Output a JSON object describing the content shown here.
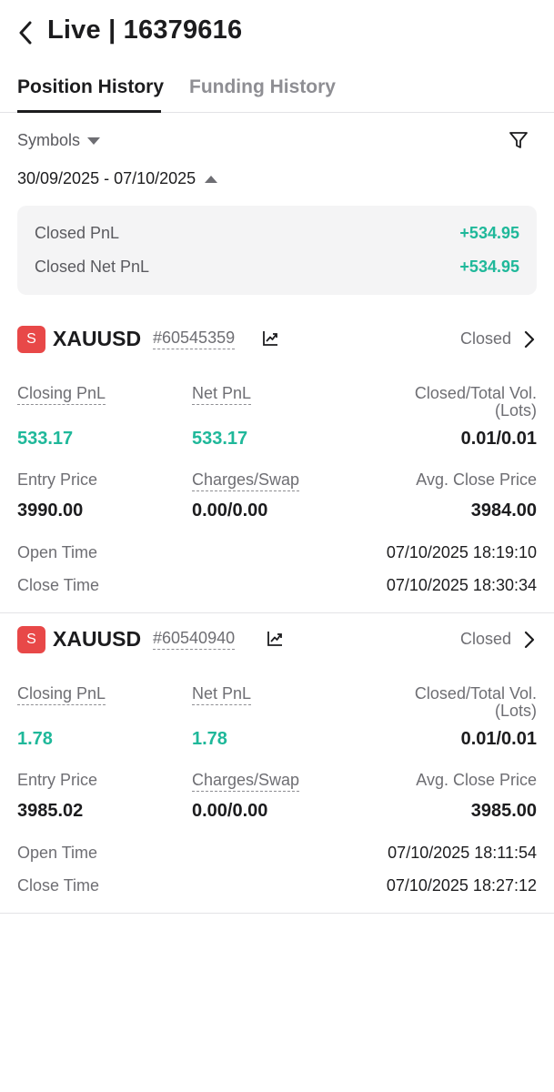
{
  "header": {
    "title": "Live | 16379616"
  },
  "tabs": [
    {
      "label": "Position History"
    },
    {
      "label": "Funding History"
    }
  ],
  "filters": {
    "symbols_label": "Symbols",
    "date_range": "30/09/2025 - 07/10/2025"
  },
  "summary": {
    "closed_pnl_label": "Closed PnL",
    "closed_pnl_value": "+534.95",
    "closed_net_pnl_label": "Closed Net PnL",
    "closed_net_pnl_value": "+534.95"
  },
  "labels": {
    "closing_pnl": "Closing PnL",
    "net_pnl": "Net PnL",
    "closed_total_vol": "Closed/Total Vol.",
    "lots": "(Lots)",
    "entry_price": "Entry Price",
    "charges_swap": "Charges/Swap",
    "avg_close_price": "Avg. Close Price",
    "open_time": "Open Time",
    "close_time": "Close Time"
  },
  "positions": [
    {
      "badge": "S",
      "symbol": "XAUUSD",
      "order_id": "#60545359",
      "status": "Closed",
      "closing_pnl": "533.17",
      "net_pnl": "533.17",
      "volume": "0.01/0.01",
      "entry_price": "3990.00",
      "charges_swap": "0.00/0.00",
      "avg_close_price": "3984.00",
      "open_time": "07/10/2025 18:19:10",
      "close_time": "07/10/2025 18:30:34"
    },
    {
      "badge": "S",
      "symbol": "XAUUSD",
      "order_id": "#60540940",
      "status": "Closed",
      "closing_pnl": "1.78",
      "net_pnl": "1.78",
      "volume": "0.01/0.01",
      "entry_price": "3985.02",
      "charges_swap": "0.00/0.00",
      "avg_close_price": "3985.00",
      "open_time": "07/10/2025 18:11:54",
      "close_time": "07/10/2025 18:27:12"
    }
  ],
  "colors": {
    "positive": "#1fb89a",
    "sell_badge": "#e84848",
    "text_primary": "#1c1c1e",
    "text_secondary": "#6e6e73"
  },
  "icons": [
    "back-arrow-icon",
    "caret-down-icon",
    "filter-icon",
    "caret-up-icon",
    "chart-icon",
    "chevron-right-icon"
  ]
}
